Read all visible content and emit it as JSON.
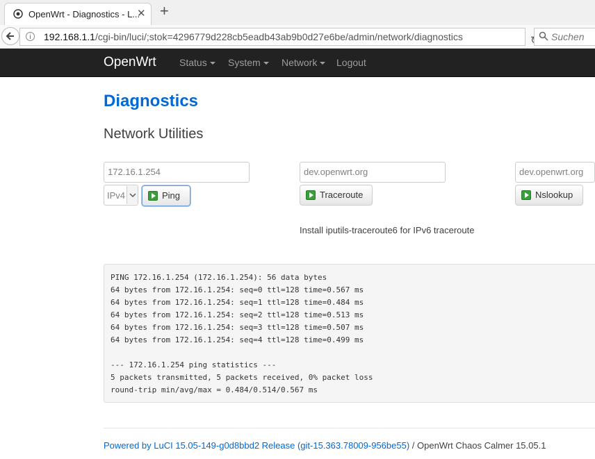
{
  "browser": {
    "tab_title": "OpenWrt - Diagnostics - L...",
    "tab_close": "✕",
    "new_tab": "+",
    "url_host": "192.168.1.1",
    "url_path": "/cgi-bin/luci/;stok=4296779d228cb5eadb43ab9b0d27e6be/admin/network/diagnostics",
    "search_placeholder": "Suchen"
  },
  "header": {
    "brand": "OpenWrt",
    "nav": [
      "Status",
      "System",
      "Network",
      "Logout"
    ]
  },
  "page": {
    "title": "Diagnostics",
    "section": "Network Utilities"
  },
  "ping": {
    "host": "172.16.1.254",
    "protocol": "IPv4",
    "button": "Ping"
  },
  "traceroute": {
    "host": "dev.openwrt.org",
    "button": "Traceroute",
    "hint": "Install iputils-traceroute6 for IPv6 traceroute"
  },
  "nslookup": {
    "host": "dev.openwrt.org",
    "button": "Nslookup"
  },
  "output": "PING 172.16.1.254 (172.16.1.254): 56 data bytes\n64 bytes from 172.16.1.254: seq=0 ttl=128 time=0.567 ms\n64 bytes from 172.16.1.254: seq=1 ttl=128 time=0.484 ms\n64 bytes from 172.16.1.254: seq=2 ttl=128 time=0.513 ms\n64 bytes from 172.16.1.254: seq=3 ttl=128 time=0.507 ms\n64 bytes from 172.16.1.254: seq=4 ttl=128 time=0.499 ms\n\n--- 172.16.1.254 ping statistics ---\n5 packets transmitted, 5 packets received, 0% packet loss\nround-trip min/avg/max = 0.484/0.514/0.567 ms",
  "footer": {
    "link": "Powered by LuCI 15.05-149-g0d8bbd2 Release (git-15.363.78009-956be55)",
    "text": " / OpenWrt Chaos Calmer 15.05.1"
  },
  "colors": {
    "link_blue": "#0069d6",
    "header_bg": "#222222",
    "button_icon_green": "#3a9e3a"
  }
}
